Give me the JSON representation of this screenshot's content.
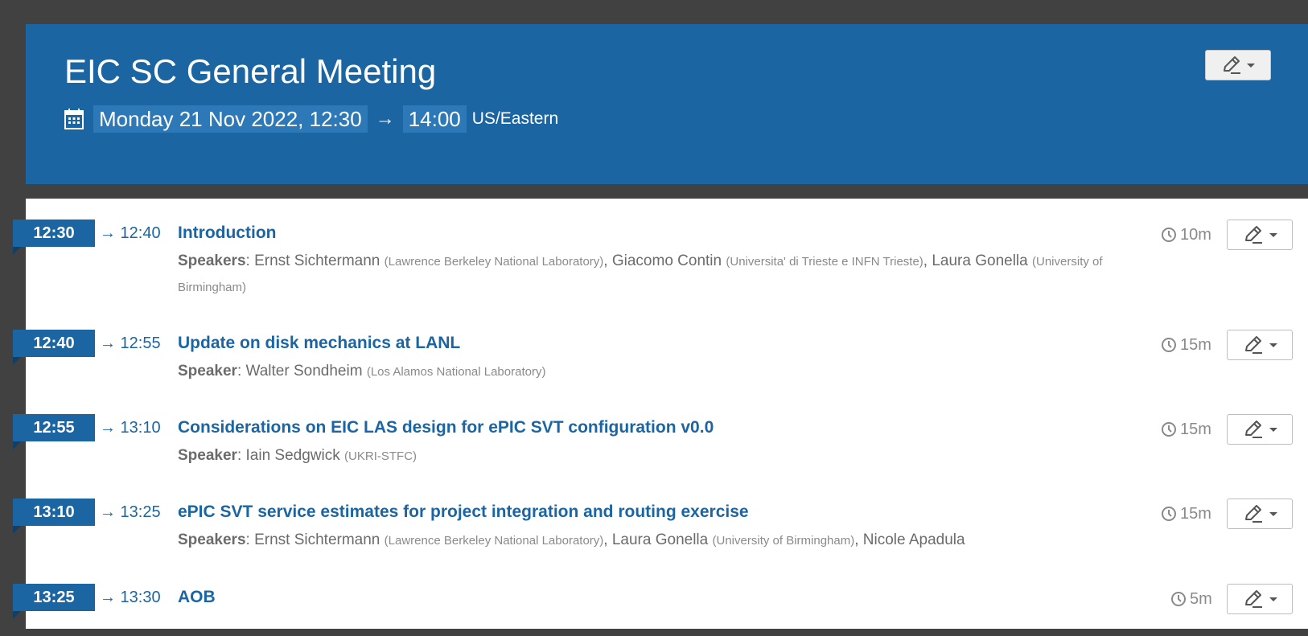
{
  "header": {
    "title": "EIC SC General Meeting",
    "start": "Monday 21 Nov 2022, 12:30",
    "arrow": "→",
    "end": "14:00",
    "timezone": "US/Eastern"
  },
  "entries": [
    {
      "start": "12:30",
      "end": "→ 12:40",
      "title": "Introduction",
      "duration": "10m",
      "speaker_label": "Speakers",
      "speakers": [
        {
          "name": "Ernst Sichtermann",
          "affiliation": "(Lawrence Berkeley National Laboratory)"
        },
        {
          "name": "Giacomo Contin",
          "affiliation": "(Universita' di Trieste e INFN Trieste)"
        },
        {
          "name": "Laura Gonella",
          "affiliation": "(University of Birmingham)"
        }
      ]
    },
    {
      "start": "12:40",
      "end": "→ 12:55",
      "title": "Update on disk mechanics at LANL",
      "duration": "15m",
      "speaker_label": "Speaker",
      "speakers": [
        {
          "name": "Walter Sondheim",
          "affiliation": "(Los Alamos National Laboratory)"
        }
      ]
    },
    {
      "start": "12:55",
      "end": "→ 13:10",
      "title": "Considerations on EIC LAS design for ePIC SVT configuration v0.0",
      "duration": "15m",
      "speaker_label": "Speaker",
      "speakers": [
        {
          "name": "Iain Sedgwick",
          "affiliation": "(UKRI-STFC)"
        }
      ]
    },
    {
      "start": "13:10",
      "end": "→ 13:25",
      "title": "ePIC SVT service estimates for project integration and routing exercise",
      "duration": "15m",
      "speaker_label": "Speakers",
      "speakers": [
        {
          "name": "Ernst Sichtermann",
          "affiliation": "(Lawrence Berkeley National Laboratory)"
        },
        {
          "name": "Laura Gonella",
          "affiliation": "(University of Birmingham)"
        },
        {
          "name": "Nicole Apadula",
          "affiliation": ""
        }
      ]
    },
    {
      "start": "13:25",
      "end": "→ 13:30",
      "title": "AOB",
      "duration": "5m",
      "speaker_label": "",
      "speakers": []
    }
  ],
  "icons": {
    "calendar": "calendar-icon",
    "clock": "clock-icon",
    "edit": "pencil-icon",
    "dropdown": "caret-down-icon"
  },
  "colors": {
    "brand_blue": "#1b65a3",
    "chip_blue": "#2d79b8",
    "background": "#414141",
    "muted_text": "#6b6b6b"
  }
}
